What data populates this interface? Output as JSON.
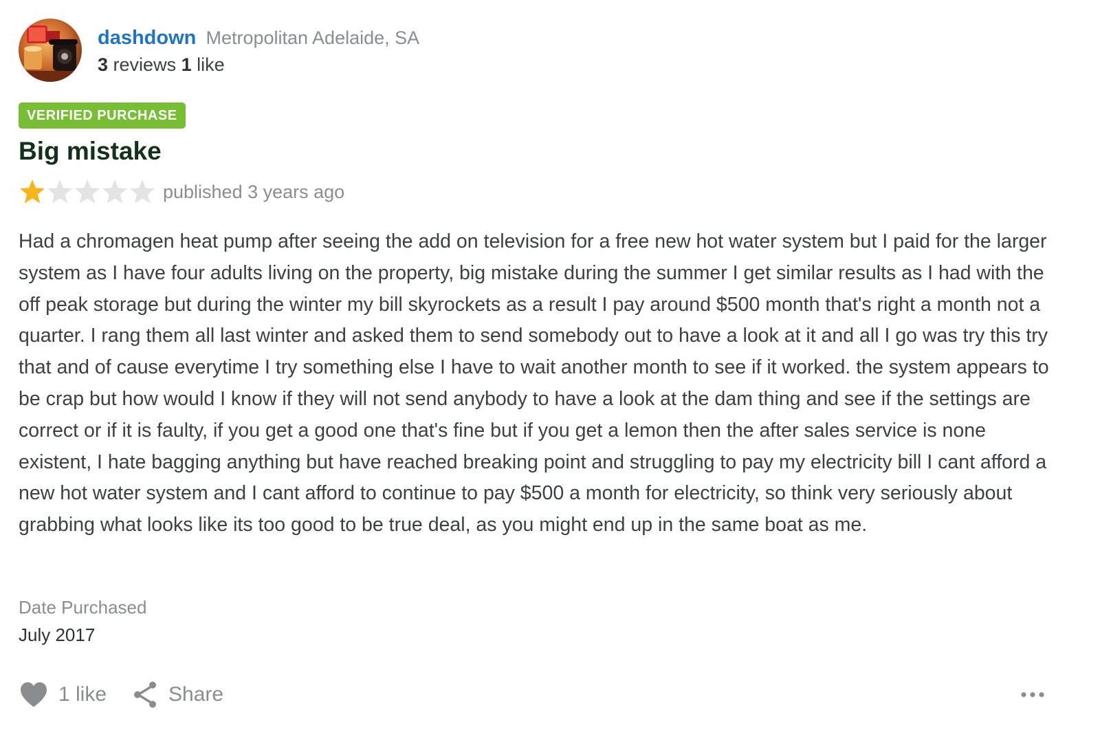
{
  "reviewer": {
    "username": "dashdown",
    "location": "Metropolitan Adelaide, SA",
    "reviews_count": "3",
    "reviews_label": "reviews",
    "likes_count": "1",
    "likes_label": "like",
    "avatar_icon": "avatar-photo-icon"
  },
  "review": {
    "badge": "VERIFIED PURCHASE",
    "title": "Big mistake",
    "rating": 1,
    "rating_max": 5,
    "published": "published 3 years ago",
    "body": "Had a chromagen heat pump after seeing the add on television for a free new hot water system but I paid for the larger system as I have four adults living on the property, big mistake during the summer I get similar results as I had with the off peak storage but during the winter my bill skyrockets as a result I pay around $500 month that's right a month not a quarter. I rang them all last winter and asked them to send somebody out to have a look at it and all I go was try this try that and of cause everytime I try something else I have to wait another month to see if it worked. the system appears to be crap but how would I know if they will not send anybody to have a look at the dam thing and see if the settings are correct or if it is faulty, if you get a good one that's fine but if you get a lemon then the after sales service is none existent, I hate bagging anything but have reached breaking point and struggling to pay my electricity bill I cant afford a new hot water system and I cant afford to continue to pay $500 a month for electricity, so think very seriously about grabbing what looks like its too good to be true deal, as you might end up in the same boat as me."
  },
  "purchase": {
    "label": "Date Purchased",
    "value": "July 2017"
  },
  "actions": {
    "like_label": "1 like",
    "share_label": "Share",
    "like_icon": "heart-icon",
    "share_icon": "share-icon",
    "more_icon": "more-options-icon"
  },
  "colors": {
    "username": "#1e74c6",
    "badge": "#78be34",
    "title": "#12321c",
    "star_filled": "#f6b619",
    "star_empty": "#e3e3e3",
    "muted": "#8a8d90"
  }
}
